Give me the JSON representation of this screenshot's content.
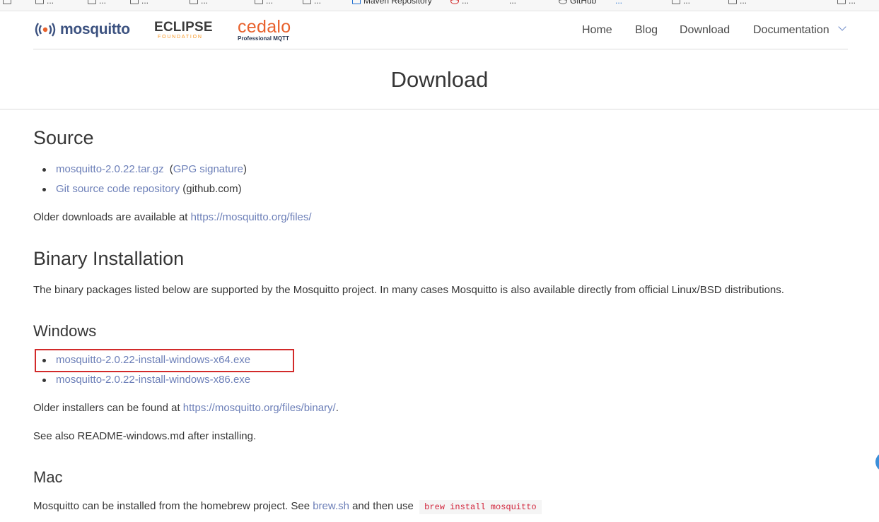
{
  "bookmarks": [
    "...",
    "...",
    "...",
    "...",
    "...",
    "...",
    "Maven Repository",
    "...",
    "...",
    "GitHub",
    "...",
    "...",
    "...",
    "..."
  ],
  "header": {
    "logos": {
      "mosquitto": "mosquitto",
      "eclipse_top": "ECLIPSE",
      "eclipse_bottom": "FOUNDATION",
      "cedalo_top": "cedalo",
      "cedalo_bottom": "Professional MQTT"
    },
    "nav": [
      "Home",
      "Blog",
      "Download",
      "Documentation"
    ]
  },
  "hero": {
    "title": "Download"
  },
  "source": {
    "heading": "Source",
    "items": [
      {
        "link": "mosquitto-2.0.22.tar.gz",
        "pre": "(",
        "link2": "GPG signature",
        "post": ")"
      },
      {
        "link": "Git source code repository",
        "post": " (github.com)"
      }
    ],
    "older_prefix": "Older downloads are available at ",
    "older_link": "https://mosquitto.org/files/"
  },
  "binary": {
    "heading": "Binary Installation",
    "intro": "The binary packages listed below are supported by the Mosquitto project. In many cases Mosquitto is also available directly from official Linux/BSD distributions."
  },
  "windows": {
    "heading": "Windows",
    "items": [
      "mosquitto-2.0.22-install-windows-x64.exe",
      "mosquitto-2.0.22-install-windows-x86.exe"
    ],
    "older_prefix": "Older installers can be found at ",
    "older_link": "https://mosquitto.org/files/binary/",
    "older_suffix": ".",
    "see_also": "See also README-windows.md after installing."
  },
  "mac": {
    "heading": "Mac",
    "text_prefix": "Mosquitto can be installed from the homebrew project. See ",
    "link": "brew.sh",
    "text_mid": " and then use ",
    "code": "brew install mosquitto"
  },
  "colors": {
    "link": "#6c7fb8",
    "highlight": "#d22a2a",
    "brand_blue": "#3c5280",
    "cedalo_orange": "#e8612c",
    "eclipse_orange": "#f7941e"
  }
}
